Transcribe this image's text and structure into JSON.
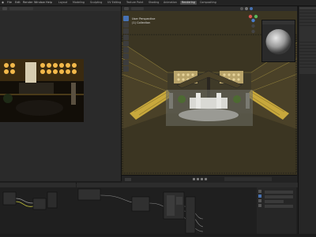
{
  "menus": [
    "File",
    "Edit",
    "Render",
    "Window",
    "Help"
  ],
  "workspace_tabs": [
    "Layout",
    "Modeling",
    "Sculpting",
    "UV Editing",
    "Texture Paint",
    "Shading",
    "Animation",
    "Rendering",
    "Compositing"
  ],
  "active_workspace_index": 7,
  "viewport": {
    "view_name": "User Perspective",
    "collection": "(1) Collection"
  },
  "colors": {
    "accent": "#4772b3",
    "floor": "#3b3522",
    "warm_light": "#e6b13a"
  },
  "icons": [
    "cursor-icon",
    "move-icon",
    "rotate-icon",
    "scale-icon",
    "transform-icon",
    "annotate-icon",
    "measure-icon",
    "camera-icon",
    "light-icon"
  ]
}
